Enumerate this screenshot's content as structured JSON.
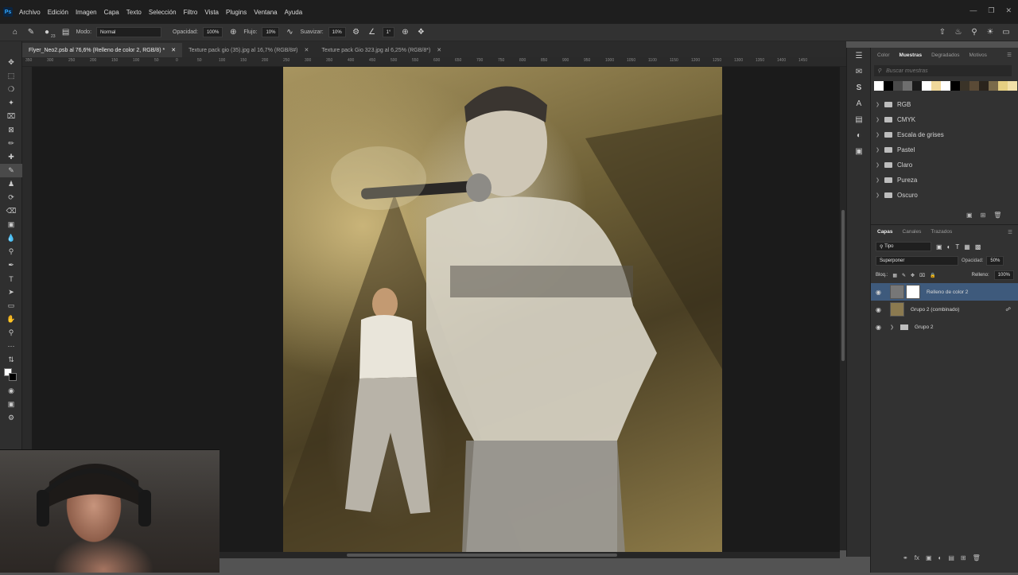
{
  "app": {
    "logo": "Ps"
  },
  "menu": [
    "Archivo",
    "Edición",
    "Imagen",
    "Capa",
    "Texto",
    "Selección",
    "Filtro",
    "Vista",
    "Plugins",
    "Ventana",
    "Ayuda"
  ],
  "options_bar": {
    "brush_size": "23",
    "mode_label": "Modo:",
    "mode_value": "Normal",
    "opacity_label": "Opacidad:",
    "opacity_value": "100%",
    "flow_label": "Flujo:",
    "flow_value": "10%",
    "smoothing_label": "Suavizar:",
    "smoothing_value": "10%",
    "angle_value": "1°"
  },
  "tabs": [
    {
      "label": "Flyer_Neo2.psb al 76,6% (Relleno de color 2, RGB/8) *",
      "active": true
    },
    {
      "label": "Texture pack gio (35).jpg al 16,7% (RGB/8#)",
      "active": false
    },
    {
      "label": "Texture pack Gio 323.jpg al 6,25% (RGB/8*)",
      "active": false
    }
  ],
  "ruler_ticks": [
    "350",
    "300",
    "250",
    "200",
    "150",
    "100",
    "50",
    "0",
    "50",
    "100",
    "150",
    "200",
    "250",
    "300",
    "350",
    "400",
    "450",
    "500",
    "550",
    "600",
    "650",
    "700",
    "750",
    "800",
    "850",
    "900",
    "950",
    "1000",
    "1050",
    "1100",
    "1150",
    "1200",
    "1250",
    "1300",
    "1350",
    "1400",
    "1450"
  ],
  "swatches_panel": {
    "tabs": [
      "Color",
      "Muestras",
      "Degradados",
      "Motivos"
    ],
    "active_tab": "Muestras",
    "search_placeholder": "Buscar muestras",
    "swatch_colors": [
      "#ffffff",
      "#000000",
      "#4a4a4a",
      "#6e6e6e",
      "#1a1a1a",
      "#ffffff",
      "#f0d89a",
      "#ffffff",
      "#000000",
      "#3a3328",
      "#5a4a36",
      "#2b241c",
      "#7a6a4a",
      "#e6cf82",
      "#f2e0a8"
    ],
    "folders": [
      "RGB",
      "CMYK",
      "Escala de grises",
      "Pastel",
      "Claro",
      "Pureza",
      "Oscuro"
    ]
  },
  "layers_panel": {
    "tabs": [
      "Capas",
      "Canales",
      "Trazados"
    ],
    "active_tab": "Capas",
    "filter_label": "Tipo",
    "blend_mode": "Superponer",
    "opacity_label": "Opacidad:",
    "opacity_value": "50%",
    "lock_label": "Bloq.:",
    "fill_label": "Relleno:",
    "fill_value": "100%",
    "layers": [
      {
        "name": "Relleno de color 2",
        "selected": true
      },
      {
        "name": "Grupo 2 (combinado)",
        "selected": false
      },
      {
        "name": "Grupo 2",
        "selected": false
      }
    ]
  }
}
